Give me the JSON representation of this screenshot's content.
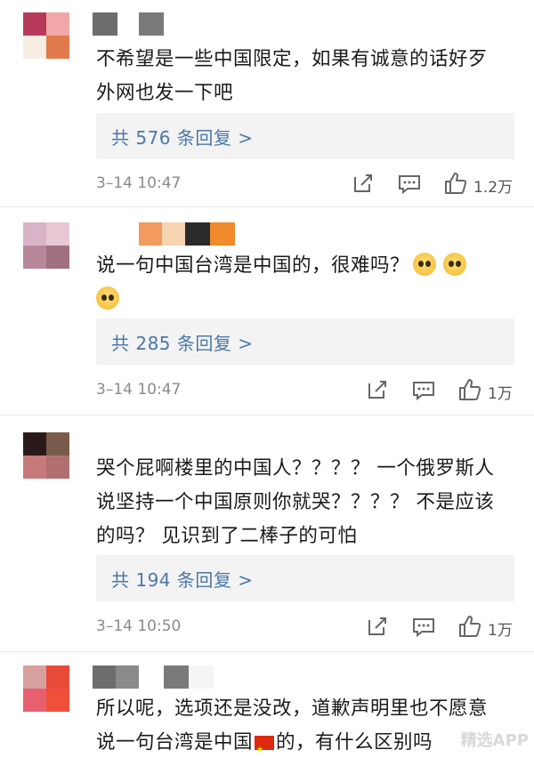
{
  "comments": [
    {
      "text_lines": [
        "不希望是一些中国限定，如果有诚意的话好歹",
        "外网也发一下吧"
      ],
      "reply_label": "共 576 条回复 >",
      "time": "3–14 10:47",
      "likes": "1.2万",
      "avatar_colors": [
        "#b83a5a",
        "#f1a7a7",
        "#f6eee3",
        "#e07a4a"
      ],
      "username_colors": [
        "#6d6d6d",
        "#ffffff",
        "#7a7a7a"
      ]
    },
    {
      "text_lines": [
        "说一句中国台湾是中国的，很难吗？",
        ""
      ],
      "reply_label": "共 285 条回复 >",
      "time": "3–14 10:47",
      "likes": "1万",
      "avatar_colors": [
        "#d9b4c8",
        "#e8c7d4",
        "#b8879a",
        "#a07080"
      ],
      "username_colors": [
        "#f39a5f",
        "#f8d4b2",
        "#2b2b2b",
        "#f08a2a"
      ]
    },
    {
      "text_lines": [
        "哭个屁啊楼里的中国人？？？？ 一个俄罗斯人",
        "说坚持一个中国原则你就哭？？？？ 不是应该",
        "的吗？ 见识到了二棒子的可怕"
      ],
      "reply_label": "共 194 条回复 >",
      "time": "3–14 10:50",
      "likes": "1万",
      "avatar_colors": [
        "#2a1a1a",
        "#7a5a4a",
        "#c77a7a",
        "#b07070"
      ],
      "username_colors": [
        "#ffffff"
      ]
    },
    {
      "text_lines": [
        "所以呢，选项还是没改，道歉声明里也不愿意",
        "说一句台湾是中国 的，有什么区别吗"
      ],
      "avatar_colors": [
        "#d9a0a0",
        "#e84a3a",
        "#e86070",
        "#f0503a"
      ],
      "username_colors": [
        "#6d6d6d",
        "#8a8a8a",
        "#ffffff",
        "#7a7a7a",
        "#f5f5f5"
      ]
    }
  ],
  "watermark": "精选APP",
  "colors": {
    "link": "#4a78a8",
    "reply_bg": "#f3f3f3",
    "meta": "#8a8a8a"
  }
}
